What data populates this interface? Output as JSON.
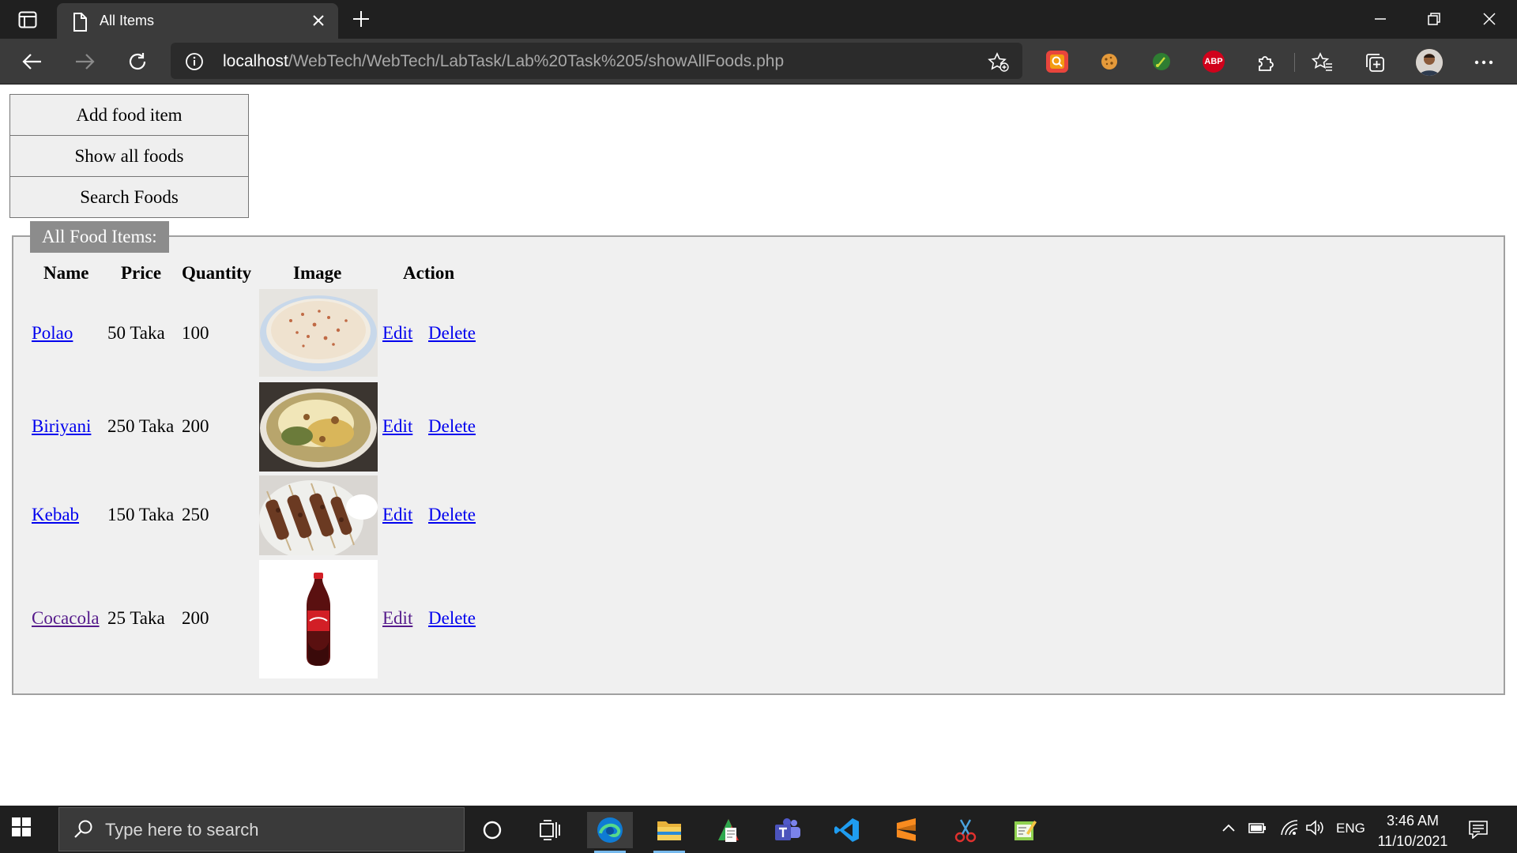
{
  "browser": {
    "tab_title": "All Items",
    "url_host": "localhost",
    "url_path": "/WebTech/WebTech/LabTask/Lab%20Task%205/showAllFoods.php",
    "extensions": [
      {
        "name": "ext-orange-icon",
        "label": "",
        "color": "#e8453c"
      },
      {
        "name": "cookie-icon",
        "label": "",
        "color": "#3b3b3b"
      },
      {
        "name": "ext-green-icon",
        "label": "",
        "color": "#2e7d32"
      },
      {
        "name": "adblock-plus-icon",
        "label": "ABP",
        "color": "#d0021b"
      }
    ]
  },
  "menu": {
    "add_label": "Add food item",
    "show_label": "Show all foods",
    "search_label": "Search Foods"
  },
  "section": {
    "legend": "All Food Items:"
  },
  "table": {
    "headers": [
      "Name",
      "Price",
      "Quantity",
      "Image",
      "Action"
    ],
    "rows": [
      {
        "name": "Polao",
        "price": "50 Taka",
        "quantity": "100",
        "image": "polao-image",
        "edit": "Edit",
        "delete": "Delete"
      },
      {
        "name": "Biriyani",
        "price": "250 Taka",
        "quantity": "200",
        "image": "biriyani-image",
        "edit": "Edit",
        "delete": "Delete"
      },
      {
        "name": "Kebab",
        "price": "150 Taka",
        "quantity": "250",
        "image": "kebab-image",
        "edit": "Edit",
        "delete": "Delete"
      },
      {
        "name": "Cocacola",
        "price": "25 Taka",
        "quantity": "200",
        "image": "cocacola-image",
        "edit": "Edit",
        "delete": "Delete"
      }
    ]
  },
  "taskbar": {
    "search_placeholder": "Type here to search",
    "language": "ENG",
    "time": "3:46 AM",
    "date": "11/10/2021"
  },
  "colors": {
    "link": "#0000ee",
    "visited_link": "#551a8b",
    "legend_bg": "#8c8c8c",
    "fieldset_bg": "#f0f0f0"
  }
}
